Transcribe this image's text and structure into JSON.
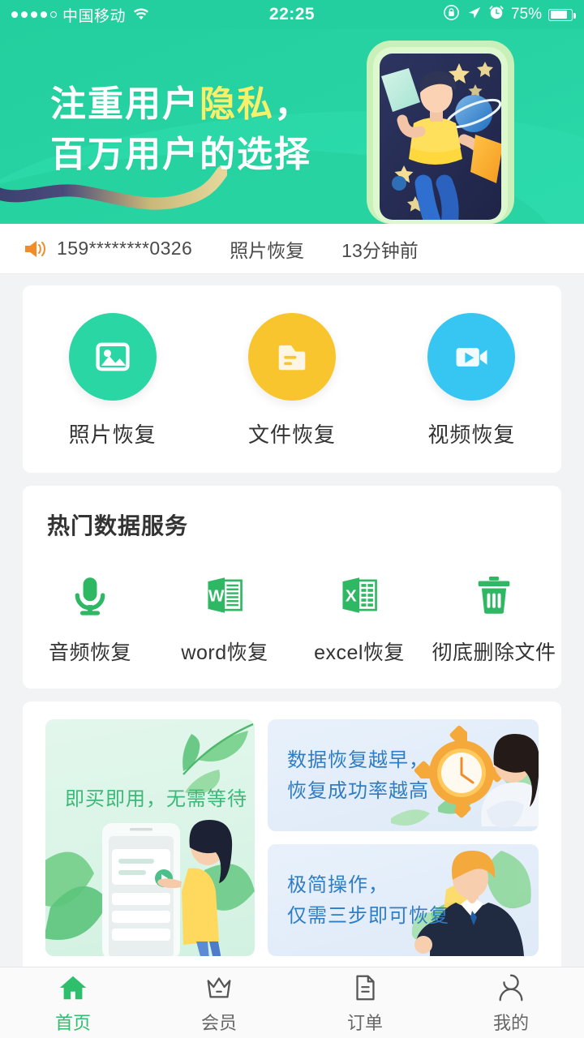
{
  "status_bar": {
    "signal_dots_filled": 4,
    "signal_dots_total": 5,
    "carrier": "中国移动",
    "wifi_icon": "wifi-icon",
    "time": "22:25",
    "rotation_lock_icon": "rotation-lock-icon",
    "location_icon": "location-arrow-icon",
    "alarm_icon": "alarm-clock-icon",
    "battery_percent": "75%",
    "battery_level": 75
  },
  "hero": {
    "line1_prefix": "注重用户",
    "line1_highlight": "隐私",
    "line1_suffix": "，",
    "line2": "百万用户的选择",
    "highlight_color": "#f6f06a",
    "bg_color": "#23cf9e",
    "illustration": "person-with-phone-stars-illustration"
  },
  "notice": {
    "speaker_icon": "speaker-icon",
    "phone": "159********0326",
    "service": "照片恢复",
    "time": "13分钟前"
  },
  "services": [
    {
      "label": "照片恢复",
      "icon": "photo-icon",
      "color": "#2ad6a3"
    },
    {
      "label": "文件恢复",
      "icon": "folder-icon",
      "color": "#f8c52e"
    },
    {
      "label": "视频恢复",
      "icon": "video-camera-icon",
      "color": "#37c5f2"
    }
  ],
  "hot_section": {
    "title": "热门数据服务",
    "items": [
      {
        "label": "音频恢复",
        "icon": "microphone-icon",
        "color": "#2fb864"
      },
      {
        "label": "word恢复",
        "icon": "word-document-icon",
        "color": "#2fb864"
      },
      {
        "label": "excel恢复",
        "icon": "excel-document-icon",
        "color": "#2fb864"
      },
      {
        "label": "彻底删除文件",
        "icon": "trash-can-icon",
        "color": "#2fb864"
      }
    ]
  },
  "promos": {
    "left": {
      "text": "即买即用，无需等待",
      "text_color": "#3cb878",
      "bg_color": "#ddf4e8",
      "illustration": "woman-pointing-at-phone-illustration"
    },
    "right_top": {
      "text": "数据恢复越早，\n恢复成功率越高",
      "text_color": "#2f7dc4",
      "bg_color": "#e4eefa",
      "illustration": "woman-holding-gear-clock-illustration"
    },
    "right_bottom": {
      "text": "极简操作，\n仅需三步即可恢复",
      "text_color": "#2f7dc4",
      "bg_color": "#e4eefa",
      "illustration": "man-in-suit-illustration"
    }
  },
  "tabbar": {
    "active_color": "#2ebf6d",
    "items": [
      {
        "label": "首页",
        "icon": "home-icon",
        "active": true
      },
      {
        "label": "会员",
        "icon": "crown-icon",
        "active": false
      },
      {
        "label": "订单",
        "icon": "order-document-icon",
        "active": false
      },
      {
        "label": "我的",
        "icon": "person-icon",
        "active": false
      }
    ]
  }
}
